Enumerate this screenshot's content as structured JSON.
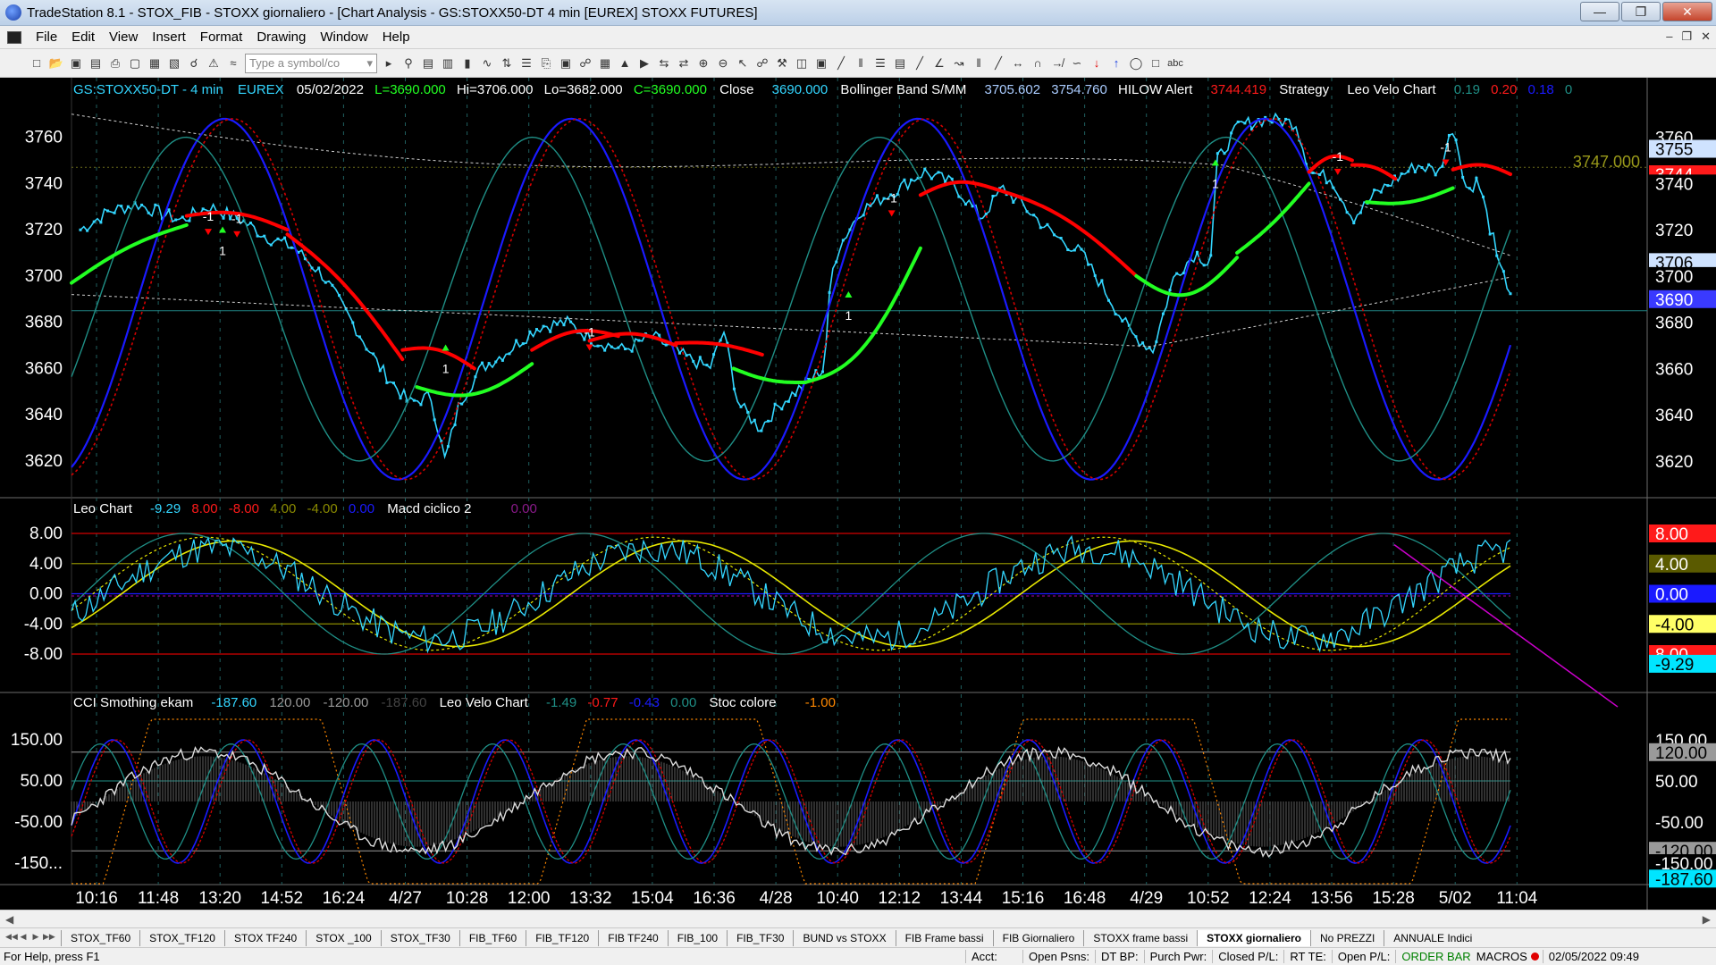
{
  "window": {
    "title": "TradeStation 8.1 - STOX_FIB - STOXX giornaliero - [Chart Analysis - GS:STOXX50-DT  4 min  [EUREX] STOXX FUTURES]"
  },
  "menu": [
    "File",
    "Edit",
    "View",
    "Insert",
    "Format",
    "Drawing",
    "Window",
    "Help"
  ],
  "toolbar": {
    "symbol_placeholder": "Type a symbol/co"
  },
  "header": {
    "symbol": "GS:STOXX50-DT - 4 min",
    "exchange": "EUREX",
    "date": "05/02/2022",
    "last": "L=3690.000",
    "high": "Hi=3706.000",
    "low": "Lo=3682.000",
    "close_eq": "C=3690.000",
    "close_label": "Close",
    "close_val": "3690.000",
    "boll_label": "Bollinger Band S/MM",
    "boll_v1": "3705.602",
    "boll_v2": "3754.760",
    "hilow_label": "HILOW Alert",
    "hilow_val": "3744.419",
    "strategy_label": "Strategy",
    "leovelo_label": "Leo Velo Chart",
    "lv1": "0.19",
    "lv2": "0.20",
    "lv3": "0.18",
    "lv4": "0"
  },
  "price_axis": {
    "ticks": [
      "3760",
      "3740",
      "3720",
      "3700",
      "3680",
      "3660",
      "3640",
      "3620"
    ],
    "tags": [
      {
        "text": "3760",
        "bg": "#000000",
        "fg": "#ffffff",
        "value": 3760
      },
      {
        "text": "3755",
        "bg": "#cfe3ff",
        "fg": "#000000",
        "value": 3755
      },
      {
        "text": "3744",
        "bg": "#ff1a1a",
        "fg": "#ffffff",
        "value": 3744
      },
      {
        "text": "3740",
        "bg": "#000000",
        "fg": "#ffffff",
        "value": 3740
      },
      {
        "text": "3720",
        "bg": "#000000",
        "fg": "#ffffff",
        "value": 3720
      },
      {
        "text": "3706",
        "bg": "#cfe3ff",
        "fg": "#000000",
        "value": 3706
      },
      {
        "text": "3700",
        "bg": "#000000",
        "fg": "#ffffff",
        "value": 3700
      },
      {
        "text": "3690",
        "bg": "#3a3aff",
        "fg": "#ffffff",
        "value": 3690
      },
      {
        "text": "3680",
        "bg": "#000000",
        "fg": "#ffffff",
        "value": 3680
      },
      {
        "text": "3660",
        "bg": "#000000",
        "fg": "#ffffff",
        "value": 3660
      },
      {
        "text": "3640",
        "bg": "#000000",
        "fg": "#ffffff",
        "value": 3640
      },
      {
        "text": "3620",
        "bg": "#000000",
        "fg": "#ffffff",
        "value": 3620
      }
    ],
    "level_label": "3747.000"
  },
  "markers": [
    "-1",
    "-1",
    "1",
    "1",
    "-1",
    "1",
    "-1",
    "1",
    "-1",
    "-1"
  ],
  "panel2": {
    "label": "Leo Chart",
    "v1": "-9.29",
    "v2": "8.00",
    "v3": "-8.00",
    "v4": "4.00",
    "v5": "-4.00",
    "v6": "0.00",
    "macd_label": "Macd ciclico 2",
    "macd_val": "0.00",
    "ticks": [
      "8.00",
      "4.00",
      "0.00",
      "-4.00",
      "-8.00"
    ],
    "tags": [
      {
        "text": "8.00",
        "bg": "#ff1a1a",
        "fg": "#ffffff",
        "value": 8
      },
      {
        "text": "4.00",
        "bg": "#5a5a00",
        "fg": "#ffffff",
        "value": 4
      },
      {
        "text": "0.00",
        "bg": "#1a1aff",
        "fg": "#ffffff",
        "value": 0
      },
      {
        "text": "-4.00",
        "bg": "#ffff66",
        "fg": "#000000",
        "value": -4
      },
      {
        "text": "8.00",
        "bg": "#ff1a1a",
        "fg": "#ffffff",
        "value": -8
      },
      {
        "text": "-9.29",
        "bg": "#00e5ff",
        "fg": "#000000",
        "value": -9.29
      }
    ]
  },
  "panel3": {
    "label": "CCI Smothing ekam",
    "v1": "-187.60",
    "v2": "120.00",
    "v3": "-120.00",
    "v4": "-187.60",
    "leovelo_label": "Leo Velo Chart",
    "lv1": "-1.49",
    "lv2": "-0.77",
    "lv3": "-0.43",
    "lv4": "0.00",
    "stoc_label": "Stoc colore",
    "stoc_val": "-1.00",
    "ticks": [
      "150.00",
      "50.00",
      "-50.00",
      "-150..."
    ],
    "tags": [
      {
        "text": "150.00",
        "bg": "#000000",
        "fg": "#ffffff",
        "value": 150
      },
      {
        "text": "120.00",
        "bg": "#9a9a9a",
        "fg": "#000000",
        "value": 120
      },
      {
        "text": "50.00",
        "bg": "#000000",
        "fg": "#ffffff",
        "value": 50
      },
      {
        "text": "-50.00",
        "bg": "#000000",
        "fg": "#ffffff",
        "value": -50
      },
      {
        "text": "-120.00",
        "bg": "#9a9a9a",
        "fg": "#000000",
        "value": -120
      },
      {
        "text": "-150.00",
        "bg": "#000000",
        "fg": "#ffffff",
        "value": -150
      },
      {
        "text": "-187.60",
        "bg": "#00e5ff",
        "fg": "#000000",
        "value": -187.6
      }
    ]
  },
  "time_axis": [
    "10:16",
    "11:48",
    "13:20",
    "14:52",
    "16:24",
    "4/27",
    "10:28",
    "12:00",
    "13:32",
    "15:04",
    "16:36",
    "4/28",
    "10:40",
    "12:12",
    "13:44",
    "15:16",
    "16:48",
    "4/29",
    "10:52",
    "12:24",
    "13:56",
    "15:28",
    "5/02",
    "11:04"
  ],
  "tabs": [
    "STOX_TF60",
    "STOX_TF120",
    "STOX TF240",
    "STOX _100",
    "STOX_TF30",
    "FIB_TF60",
    "FIB_TF120",
    "FIB TF240",
    "FIB_100",
    "FIB_TF30",
    "BUND vs STOXX",
    "FIB Frame bassi",
    "FIB Giornaliero",
    "STOXX frame bassi",
    "STOXX giornaliero",
    "No PREZZI",
    "ANNUALE Indici"
  ],
  "active_tab": "STOXX giornaliero",
  "status": {
    "help": "For Help, press F1",
    "acct": "Acct:",
    "open_psns": "Open Psns:",
    "dt_bp": "DT BP:",
    "purch_pwr": "Purch Pwr:",
    "closed_pl": "Closed P/L:",
    "rt_te": "RT TE:",
    "open_pl": "Open P/L:",
    "order_bar": "ORDER BAR",
    "macros": "MACROS",
    "datetime": "02/05/2022 09:49"
  },
  "colors": {
    "price": "#33d6ff",
    "hilow_red": "#ff0000",
    "hilow_green": "#22ff22",
    "cycle_blue": "#1a1aff",
    "cycle_red": "#d40000",
    "cycle_teal": "#1f8f86",
    "yellow": "#e8e800",
    "magenta": "#cc00cc"
  }
}
